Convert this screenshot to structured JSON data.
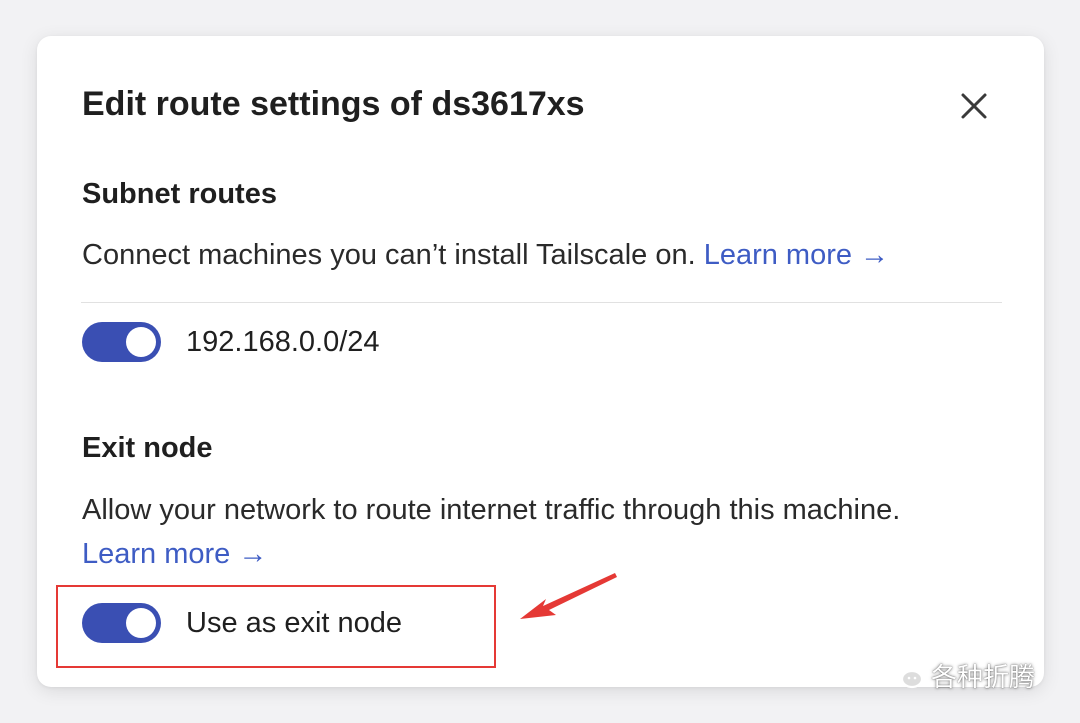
{
  "dialog": {
    "title": "Edit route settings of ds3617xs",
    "close_icon": "close-icon"
  },
  "subnet": {
    "heading": "Subnet routes",
    "description": "Connect machines you can’t install Tailscale on.",
    "learn_more": "Learn more →",
    "routes": [
      {
        "label": "192.168.0.0/24",
        "enabled": true
      }
    ]
  },
  "exit_node": {
    "heading": "Exit node",
    "description": "Allow your network to route internet traffic through this machine.",
    "learn_more": "Learn more →",
    "toggle_label": "Use as exit node",
    "enabled": true
  },
  "annotation": {
    "highlight_color": "#e53935",
    "arrow_color": "#e53935"
  },
  "watermark": {
    "icon": "wechat-icon",
    "text": "各种折腾"
  },
  "colors": {
    "accent": "#3a4fb3",
    "link": "#3e5cc4"
  }
}
